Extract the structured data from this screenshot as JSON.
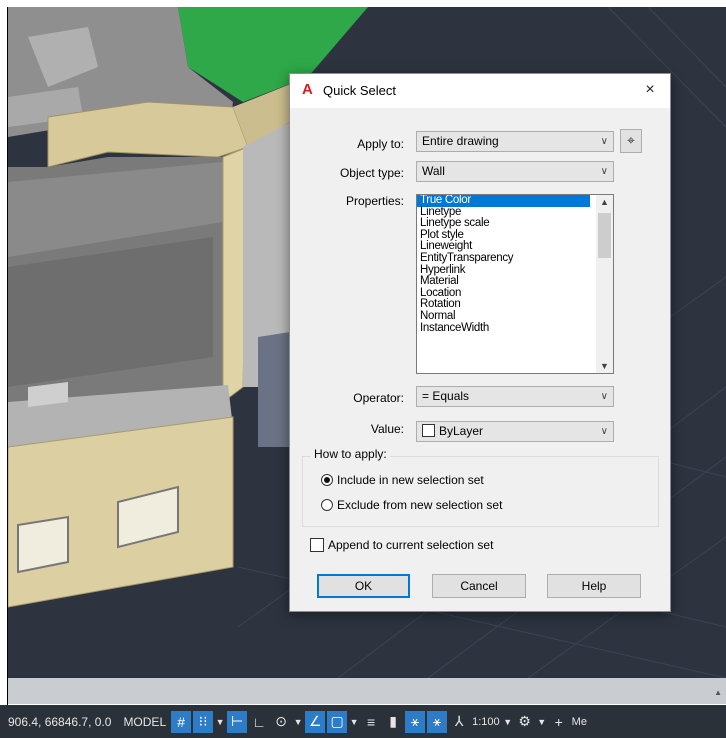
{
  "dialog": {
    "title": "Quick Select",
    "close_glyph": "×",
    "apply_to": {
      "label": "Apply to:",
      "value": "Entire drawing"
    },
    "object_type": {
      "label": "Object type:",
      "value": "Wall"
    },
    "properties": {
      "label": "Properties:",
      "selected": "True Color",
      "items": [
        "True Color",
        "Linetype",
        "Linetype scale",
        "Plot style",
        "Lineweight",
        "EntityTransparency",
        "Hyperlink",
        "Material",
        "Location",
        "Rotation",
        "Normal",
        "InstanceWidth"
      ]
    },
    "operator": {
      "label": "Operator:",
      "value": "= Equals"
    },
    "value": {
      "label": "Value:",
      "value": "ByLayer"
    },
    "how_to_apply": {
      "legend": "How to apply:",
      "include_label": "Include in new selection set",
      "exclude_label": "Exclude from new selection set",
      "selected": "include"
    },
    "append": {
      "label": "Append to current selection set",
      "checked": false
    },
    "buttons": {
      "ok": "OK",
      "cancel": "Cancel",
      "help": "Help"
    }
  },
  "statusbar": {
    "coordinates": "906.4, 66846.7, 0.0",
    "model_label": "MODEL",
    "scale": "1:100",
    "truncated_label": "Me"
  },
  "colors": {
    "accent": "#0078d7",
    "status_on": "#2c7cc8",
    "statusbar_bg": "#2b3139",
    "canvas_bg": "#2d3440",
    "autocad_red": "#d81e1e"
  }
}
